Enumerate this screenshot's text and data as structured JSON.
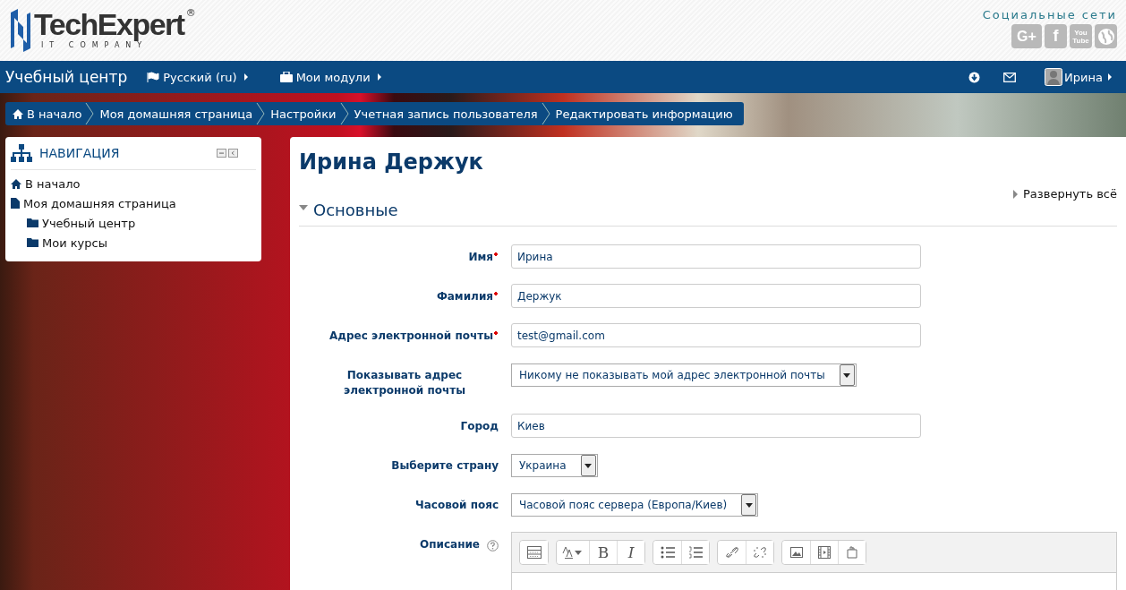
{
  "logo": {
    "name": "TechExpert",
    "reg": "®",
    "tagline": "IT COMPANY"
  },
  "social": {
    "title": "Социальные сети",
    "items": [
      {
        "kind": "gplus",
        "label": "G+"
      },
      {
        "kind": "facebook",
        "label": "f"
      },
      {
        "kind": "youtube",
        "lines": [
          "You",
          "Tube"
        ]
      },
      {
        "kind": "globe"
      }
    ]
  },
  "navbar": {
    "brand": "Учебный центр",
    "menus": [
      {
        "kind": "language",
        "label": "Русский (ru)"
      },
      {
        "kind": "modules",
        "label": "Мои модули"
      }
    ],
    "user": "Ирина"
  },
  "breadcrumb": [
    {
      "kind": "home",
      "label": "В начало"
    },
    {
      "label": "Моя домашняя страница"
    },
    {
      "label": "Настройки"
    },
    {
      "label": "Учетная запись пользователя"
    },
    {
      "label": "Редактировать информацию"
    }
  ],
  "navigation": {
    "title": "НАВИГАЦИЯ",
    "items": [
      {
        "kind": "home",
        "label": "В начало"
      },
      {
        "kind": "page",
        "label": "Моя домашняя страница",
        "children": [
          {
            "kind": "folder",
            "label": "Учебный центр"
          },
          {
            "kind": "folder",
            "label": "Мои курсы"
          }
        ]
      }
    ]
  },
  "page": {
    "title": "Ирина Держук",
    "expand_all": "Развернуть всё",
    "section": {
      "title": "Основные",
      "expanded": true
    },
    "fields": [
      {
        "kind": "text",
        "label": "Имя",
        "required": true,
        "value": "Ирина"
      },
      {
        "kind": "text",
        "label": "Фамилия",
        "required": true,
        "value": "Держук"
      },
      {
        "kind": "text",
        "label": "Адрес электронной почты",
        "required": true,
        "value": "test@gmail.com"
      },
      {
        "kind": "select",
        "label": "Показывать адрес электронной почты",
        "required": false,
        "value": "Никому не показывать мой адрес электронной почты"
      },
      {
        "kind": "text",
        "label": "Город",
        "required": false,
        "value": "Киев"
      },
      {
        "kind": "select",
        "label": "Выберите страну",
        "required": false,
        "value": "Украина"
      },
      {
        "kind": "select",
        "label": "Часовой пояс",
        "required": false,
        "value": "Часовой пояс сервера (Европа/Киев)"
      },
      {
        "kind": "editor",
        "label": "Описание",
        "required": false,
        "help": true,
        "bold": "B",
        "italic": "I"
      }
    ]
  }
}
